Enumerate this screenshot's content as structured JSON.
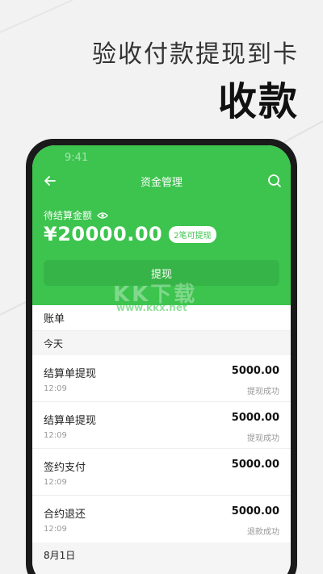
{
  "headline": {
    "sub": "验收付款提现到卡",
    "main": "收款"
  },
  "status_bar": {
    "time": "9:41"
  },
  "nav": {
    "title": "资金管理",
    "back_icon": "back-arrow-icon",
    "search_icon": "search-icon"
  },
  "balance": {
    "label": "待结算金额",
    "amount": "¥20000.00",
    "badge": "2笔可提现",
    "eye_icon": "eye-icon"
  },
  "withdraw_button": {
    "label": "提现"
  },
  "watermark": {
    "text": "KK下载",
    "url": "www.kkx.net"
  },
  "ledger": {
    "title": "账单",
    "groups": [
      {
        "date": "今天",
        "items": [
          {
            "name": "结算单提现",
            "amount": "5000.00",
            "time": "12:09",
            "status": "提现成功"
          },
          {
            "name": "结算单提现",
            "amount": "5000.00",
            "time": "12:09",
            "status": "提现成功"
          },
          {
            "name": "签约支付",
            "amount": "5000.00",
            "time": "12:09",
            "status": ""
          },
          {
            "name": "合约退还",
            "amount": "5000.00",
            "time": "12:09",
            "status": "退款成功"
          }
        ]
      },
      {
        "date": "8月1日",
        "items": []
      }
    ]
  },
  "colors": {
    "brand_green": "#3cc44e",
    "background": "#f2f2f2"
  }
}
